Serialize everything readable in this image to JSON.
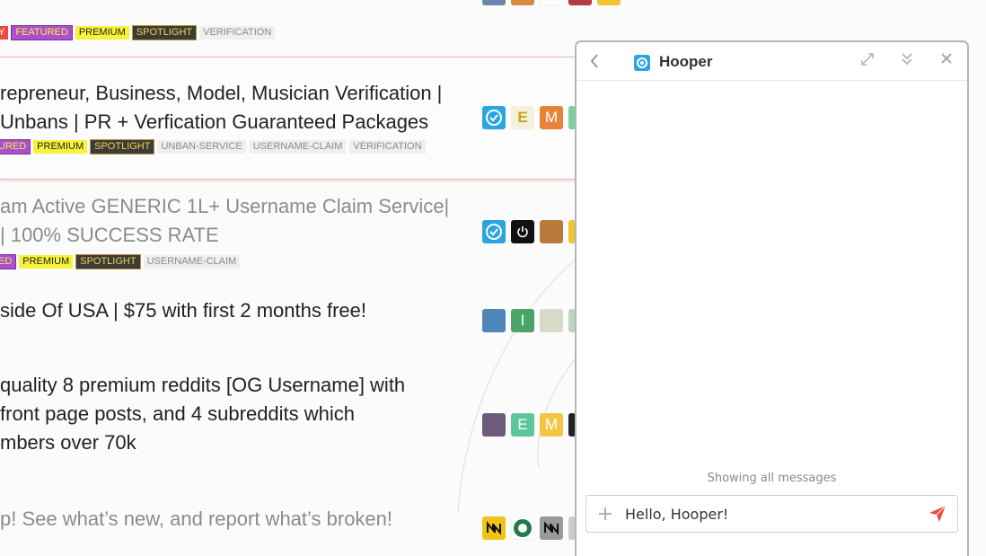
{
  "threads": [
    {
      "title_lines": [],
      "tags": [
        "Y",
        "FEATURED",
        "PREMIUM",
        "SPOTLIGHT",
        "VERIFICATION"
      ]
    },
    {
      "title_lines": [
        "repreneur, Business, Model, Musician Verification |",
        "Unbans | PR + Verfication Guaranteed Packages"
      ],
      "tags": [
        "URED",
        "PREMIUM",
        "SPOTLIGHT",
        "UNBAN-SERVICE",
        "USERNAME-CLAIM",
        "VERIFICATION"
      ],
      "avatars": [
        "E",
        "M"
      ]
    },
    {
      "title_lines": [
        "am Active GENERIC 1L+ Username Claim Service|",
        "| 100% SUCCESS RATE"
      ],
      "tags": [
        "ED",
        "PREMIUM",
        "SPOTLIGHT",
        "USERNAME-CLAIM"
      ]
    },
    {
      "title_lines": [
        "side Of USA | $75 with first 2 months free!"
      ],
      "avatars": [
        "I"
      ]
    },
    {
      "title_lines": [
        "quality 8 premium reddits [OG Username] with",
        "front page posts, and 4 subreddits which",
        "mbers over 70k"
      ],
      "avatars": [
        "E",
        "M"
      ]
    },
    {
      "title_lines": [
        "p! See what’s new, and report what’s broken!"
      ]
    }
  ],
  "chat": {
    "title": "Hooper",
    "status": "Showing all messages",
    "message_value": "Hello, Hooper!",
    "icons": {
      "back": "chevron-left-icon",
      "expand": "expand-icon",
      "minimize": "double-chevron-down-icon",
      "close": "close-icon",
      "add": "plus-icon",
      "send": "send-icon"
    }
  },
  "colors": {
    "featured": "#a94fcf",
    "premium": "#f9f23a",
    "spotlight": "#3b3b3b",
    "hot": "#e74c3c",
    "accent_send": "#e74c3c"
  }
}
